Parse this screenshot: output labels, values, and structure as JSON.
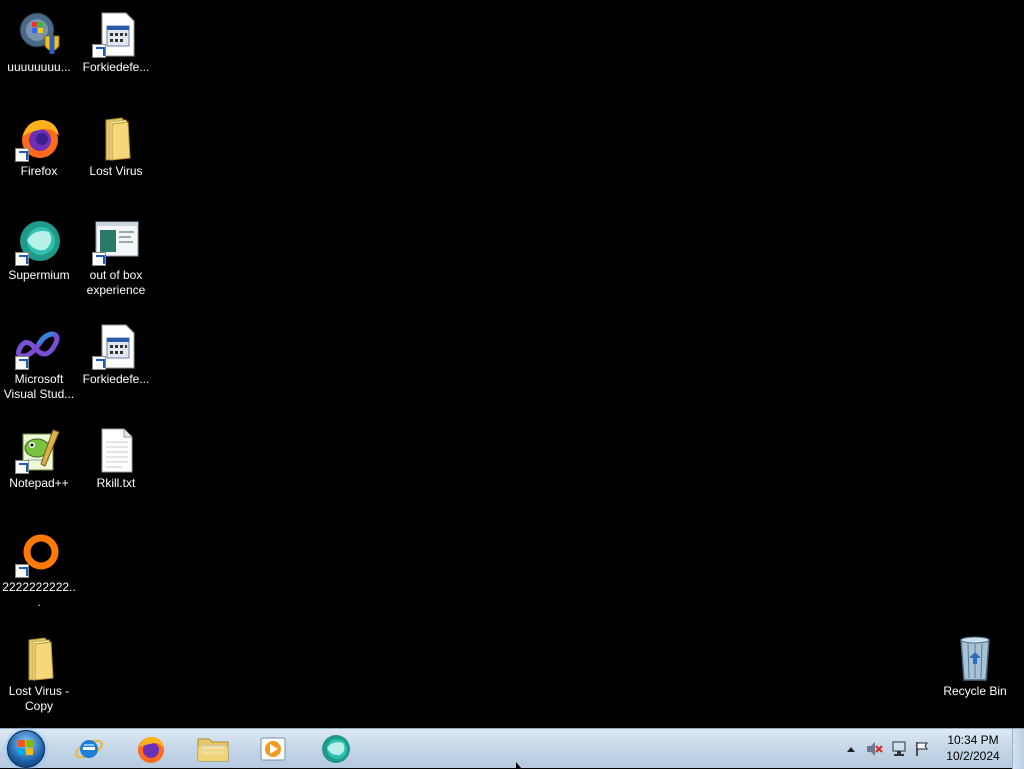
{
  "desktop": {
    "icons": [
      {
        "label": "uuuuuuuu...",
        "icon": "control-panel-shield-icon"
      },
      {
        "label": "Forkiedefe...",
        "icon": "program-window-icon"
      },
      {
        "label": "Firefox",
        "icon": "firefox-icon"
      },
      {
        "label": "Lost Virus",
        "icon": "folder-icon"
      },
      {
        "label": "Supermium",
        "icon": "supermium-icon"
      },
      {
        "label": "out of box experience",
        "icon": "oobe-window-icon"
      },
      {
        "label": "Microsoft Visual Stud...",
        "icon": "visual-studio-icon"
      },
      {
        "label": "Forkiedefe...",
        "icon": "program-window-icon"
      },
      {
        "label": "Notepad++",
        "icon": "notepad-plus-plus-icon"
      },
      {
        "label": "Rkill.txt",
        "icon": "text-file-icon"
      },
      {
        "label": "2222222222...",
        "icon": "orange-ring-icon"
      },
      {
        "label": "Lost Virus - Copy",
        "icon": "folder-icon"
      },
      {
        "label": "Recycle Bin",
        "icon": "recycle-bin-icon"
      }
    ]
  },
  "taskbar": {
    "start": "start-orb-icon",
    "pinned": [
      {
        "name": "internet-explorer",
        "icon": "internet-explorer-icon"
      },
      {
        "name": "firefox",
        "icon": "firefox-icon"
      },
      {
        "name": "file-explorer",
        "icon": "folder-icon"
      },
      {
        "name": "media-player",
        "icon": "media-player-icon"
      },
      {
        "name": "supermium",
        "icon": "supermium-icon"
      }
    ],
    "tray": {
      "icons": [
        "show-hidden-icons-icon",
        "volume-muted-icon",
        "network-icon",
        "action-center-flag-icon"
      ],
      "time": "10:34 PM",
      "date": "10/2/2024"
    }
  },
  "colors": {
    "desktop_bg": "#000000",
    "taskbar_top": "#dfeaf4",
    "taskbar_bottom": "#b6cbe0"
  }
}
